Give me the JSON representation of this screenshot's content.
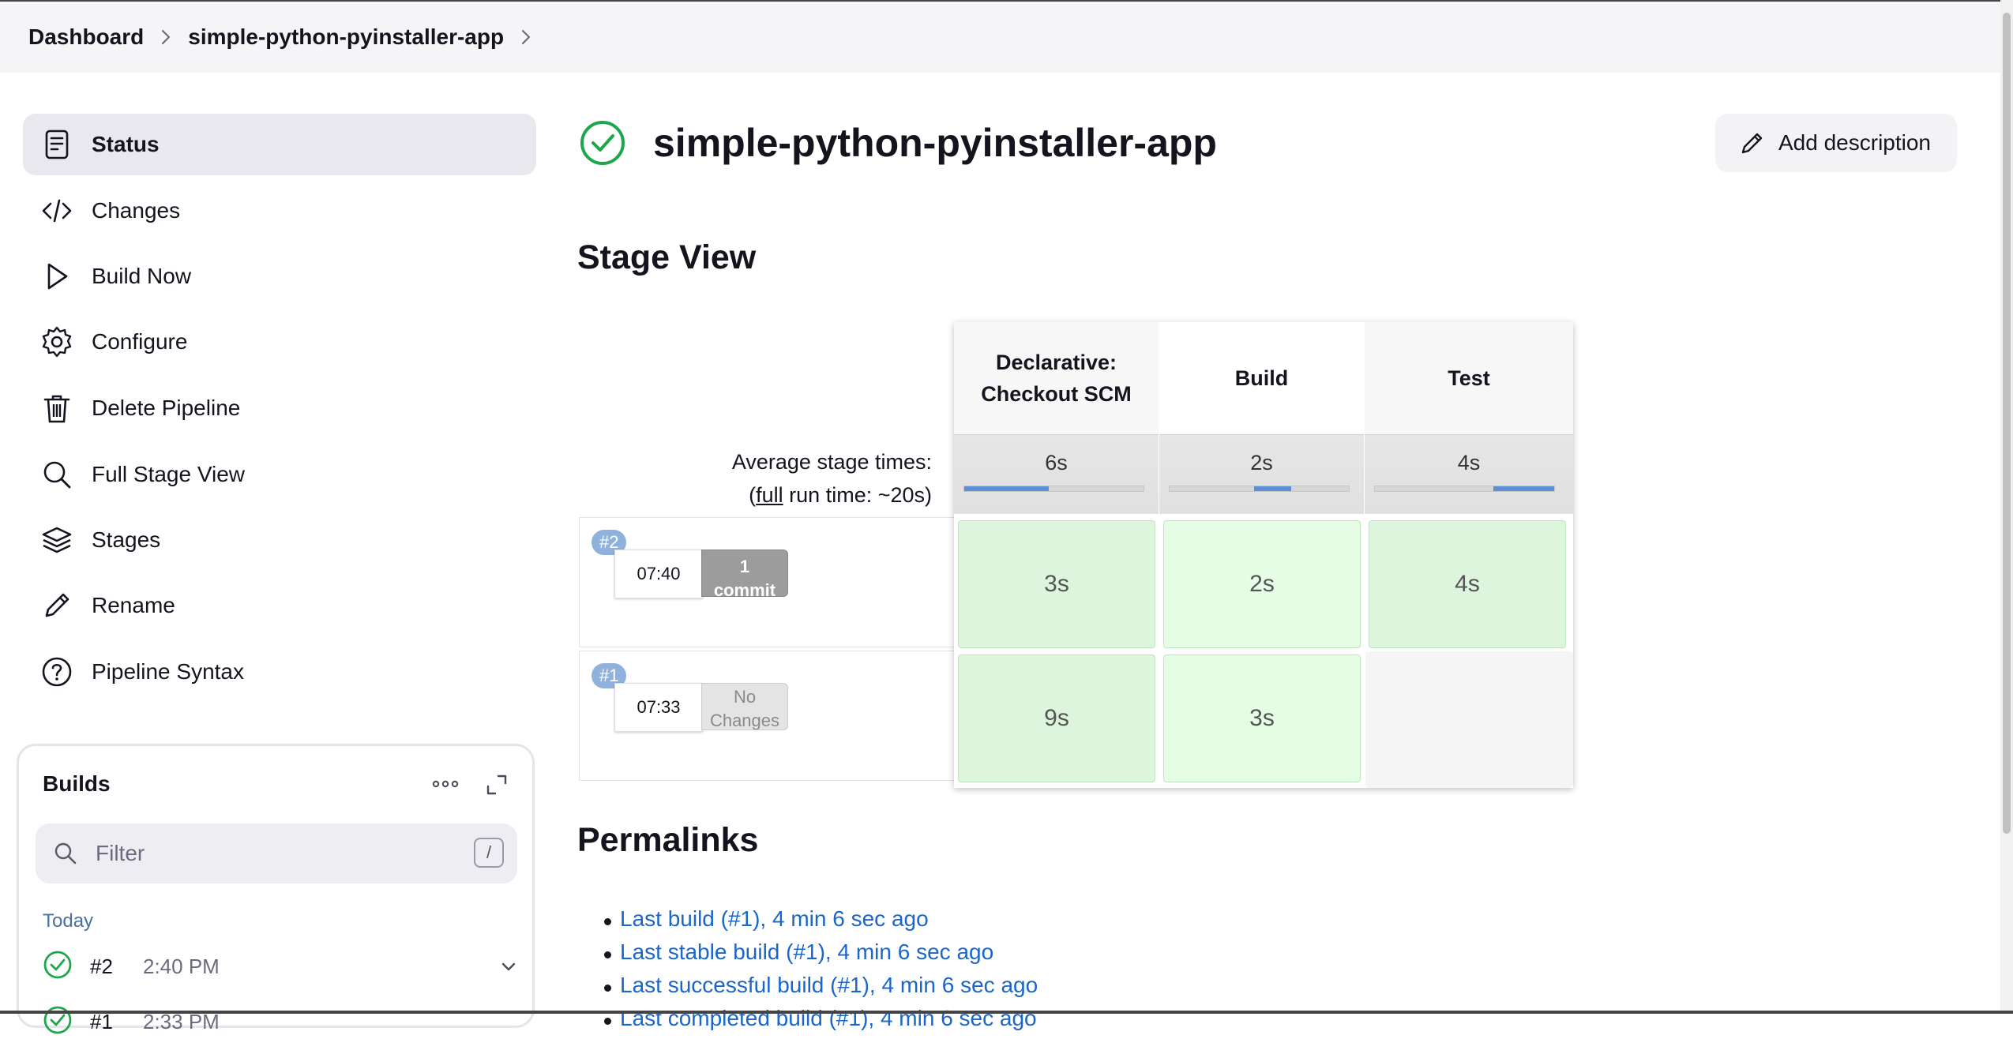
{
  "breadcrumb": {
    "items": [
      "Dashboard",
      "simple-python-pyinstaller-app"
    ]
  },
  "sidebar": {
    "items": [
      {
        "label": "Status",
        "icon": "document-icon",
        "active": true
      },
      {
        "label": "Changes",
        "icon": "code-icon"
      },
      {
        "label": "Build Now",
        "icon": "play-icon"
      },
      {
        "label": "Configure",
        "icon": "gear-icon"
      },
      {
        "label": "Delete Pipeline",
        "icon": "trash-icon"
      },
      {
        "label": "Full Stage View",
        "icon": "search-icon"
      },
      {
        "label": "Stages",
        "icon": "layers-icon"
      },
      {
        "label": "Rename",
        "icon": "pencil-icon"
      },
      {
        "label": "Pipeline Syntax",
        "icon": "help-icon"
      }
    ]
  },
  "builds": {
    "title": "Builds",
    "filter_placeholder": "Filter",
    "filter_shortcut": "/",
    "group_label": "Today",
    "items": [
      {
        "number": "#2",
        "time": "2:40 PM",
        "status": "success"
      },
      {
        "number": "#1",
        "time": "2:33 PM",
        "status": "success"
      }
    ]
  },
  "main": {
    "title": "simple-python-pyinstaller-app",
    "add_description_label": "Add description",
    "stage_view_heading": "Stage View",
    "permalinks_heading": "Permalinks"
  },
  "stage_view": {
    "avg_label": "Average stage times:",
    "full_run_prefix": "(",
    "full_run_link": "full",
    "full_run_suffix": " run time: ~20s)",
    "stages": [
      {
        "name_line1": "Declarative:",
        "name_line2": "Checkout SCM",
        "avg": "6s",
        "progress_start": 0.0,
        "progress_end": 0.47
      },
      {
        "name_line1": "Build",
        "name_line2": "",
        "avg": "2s",
        "progress_start": 0.47,
        "progress_end": 0.68
      },
      {
        "name_line1": "Test",
        "name_line2": "",
        "avg": "4s",
        "progress_start": 0.66,
        "progress_end": 1.0
      }
    ],
    "runs": [
      {
        "badge": "#2",
        "time": "07:40",
        "changes_line1": "1",
        "changes_line2": "commit",
        "has_changes": true,
        "durations": [
          "3s",
          "2s",
          "4s"
        ]
      },
      {
        "badge": "#1",
        "time": "07:33",
        "changes_line1": "No",
        "changes_line2": "Changes",
        "has_changes": false,
        "durations": [
          "9s",
          "3s",
          ""
        ]
      }
    ]
  },
  "permalinks": [
    "Last build (#1), 4 min 6 sec ago",
    "Last stable build (#1), 4 min 6 sec ago",
    "Last successful build (#1), 4 min 6 sec ago",
    "Last completed build (#1), 4 min 6 sec ago"
  ],
  "colors": {
    "success": "#1ea64b",
    "link": "#1a66c9",
    "progress": "#5d8fd3",
    "stage_success_dark": "#dcf5dc",
    "stage_success_light": "#e5fde5"
  }
}
